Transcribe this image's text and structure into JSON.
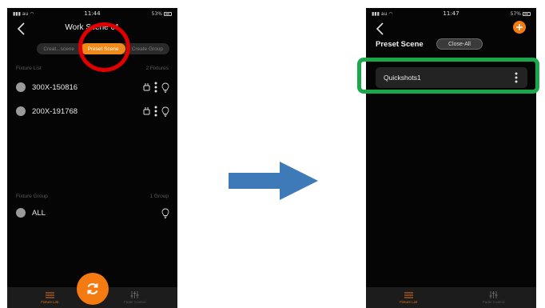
{
  "colors": {
    "accent": "#f28a1a",
    "annotation_circle": "#e00000",
    "annotation_box": "#1aa84a",
    "arrow": "#3e7ab8"
  },
  "left_screen": {
    "status": {
      "carrier": "au",
      "time": "11:44",
      "battery": "53%"
    },
    "title": "Work Scene 01",
    "tabs": [
      {
        "label": "Creat...scene"
      },
      {
        "label": "Preset Scene"
      },
      {
        "label": "Create Group"
      }
    ],
    "fixture_list": {
      "label": "Fixture List",
      "count": "2 Fixtures",
      "items": [
        {
          "name": "300X-150816"
        },
        {
          "name": "200X-191768"
        }
      ]
    },
    "fixture_group": {
      "label": "Fixture Group",
      "count": "1 Group",
      "items": [
        {
          "name": "ALL"
        }
      ]
    },
    "bottom_nav": [
      {
        "label": "Fixture List"
      },
      {
        "label": "Fader Control"
      }
    ]
  },
  "right_screen": {
    "status": {
      "carrier": "au",
      "time": "11:47",
      "battery": "57%"
    },
    "header": "Preset Scene",
    "close_all_label": "Close-All",
    "scenes": [
      {
        "name": "Quickshots1"
      }
    ],
    "bottom_nav": [
      {
        "label": "Fixture List"
      },
      {
        "label": "Fader Control"
      }
    ]
  }
}
